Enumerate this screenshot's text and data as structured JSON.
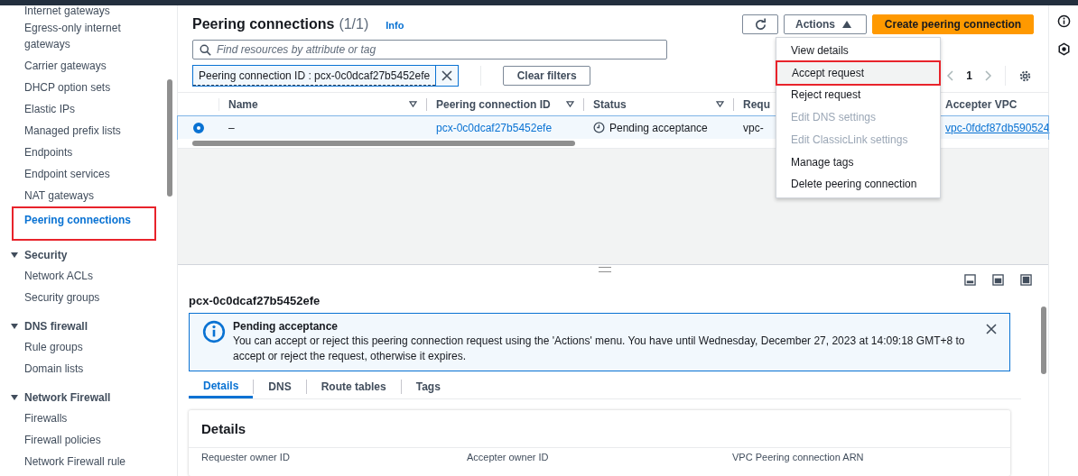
{
  "sidebar": {
    "items": [
      {
        "kind": "link",
        "label": "Internet gateways",
        "selected": false,
        "highlighted": false
      },
      {
        "kind": "link",
        "label": "Egress-only internet gateways",
        "selected": false,
        "highlighted": false
      },
      {
        "kind": "link",
        "label": "Carrier gateways",
        "selected": false,
        "highlighted": false
      },
      {
        "kind": "link",
        "label": "DHCP option sets",
        "selected": false,
        "highlighted": false
      },
      {
        "kind": "link",
        "label": "Elastic IPs",
        "selected": false,
        "highlighted": false
      },
      {
        "kind": "link",
        "label": "Managed prefix lists",
        "selected": false,
        "highlighted": false
      },
      {
        "kind": "link",
        "label": "Endpoints",
        "selected": false,
        "highlighted": false
      },
      {
        "kind": "link",
        "label": "Endpoint services",
        "selected": false,
        "highlighted": false
      },
      {
        "kind": "link",
        "label": "NAT gateways",
        "selected": false,
        "highlighted": false
      },
      {
        "kind": "link",
        "label": "Peering connections",
        "selected": true,
        "highlighted": true
      },
      {
        "kind": "section",
        "label": "Security",
        "expanded": true,
        "children": [
          {
            "label": "Network ACLs",
            "selected": false
          },
          {
            "label": "Security groups",
            "selected": false
          }
        ]
      },
      {
        "kind": "section",
        "label": "DNS firewall",
        "expanded": true,
        "children": [
          {
            "label": "Rule groups",
            "selected": false
          },
          {
            "label": "Domain lists",
            "selected": false
          }
        ]
      },
      {
        "kind": "section",
        "label": "Network Firewall",
        "expanded": true,
        "children": [
          {
            "label": "Firewalls",
            "selected": false
          },
          {
            "label": "Firewall policies",
            "selected": false
          },
          {
            "label": "Network Firewall rule",
            "selected": false
          }
        ]
      }
    ]
  },
  "header": {
    "title": "Peering connections",
    "count": "(1/1)",
    "info": "Info"
  },
  "toolbar": {
    "actions": "Actions",
    "actions_expanded": true,
    "create": "Create peering connection"
  },
  "search": {
    "placeholder": "Find resources by attribute or tag"
  },
  "filter": {
    "token": "Peering connection ID : pcx-0c0dcaf27b5452efe",
    "clear": "Clear filters"
  },
  "pagination": {
    "page": "1"
  },
  "actions_menu": [
    {
      "label": "View details",
      "disabled": false,
      "highlighted": false
    },
    {
      "label": "Accept request",
      "disabled": false,
      "highlighted": true
    },
    {
      "label": "Reject request",
      "disabled": false,
      "highlighted": false
    },
    {
      "label": "Edit DNS settings",
      "disabled": true,
      "highlighted": false
    },
    {
      "label": "Edit ClassicLink settings",
      "disabled": true,
      "highlighted": false
    },
    {
      "label": "Manage tags",
      "disabled": false,
      "highlighted": false
    },
    {
      "label": "Delete peering connection",
      "disabled": false,
      "highlighted": false
    }
  ],
  "table": {
    "columns": [
      "Name",
      "Peering connection ID",
      "Status",
      "Requ",
      "Accepter VPC"
    ],
    "rows": [
      {
        "selected": true,
        "name": "–",
        "id": "pcx-0c0dcaf27b5452efe",
        "status": "Pending acceptance",
        "column_4": "vpc-",
        "accepter_vpc": "vpc-0fdcf87db590524"
      }
    ]
  },
  "detail": {
    "title": "pcx-0c0dcaf27b5452efe",
    "alert": {
      "title": "Pending acceptance",
      "message": "You can accept or reject this peering connection request using the 'Actions' menu. You have until Wednesday, December 27, 2023 at 14:09:18 GMT+8 to accept or reject the request, otherwise it expires."
    },
    "tabs": [
      {
        "label": "Details",
        "selected": true
      },
      {
        "label": "DNS",
        "selected": false
      },
      {
        "label": "Route tables",
        "selected": false
      },
      {
        "label": "Tags",
        "selected": false
      }
    ],
    "panel_title": "Details",
    "fields": [
      "Requester owner ID",
      "Accepter owner ID",
      "VPC Peering connection ARN"
    ]
  }
}
